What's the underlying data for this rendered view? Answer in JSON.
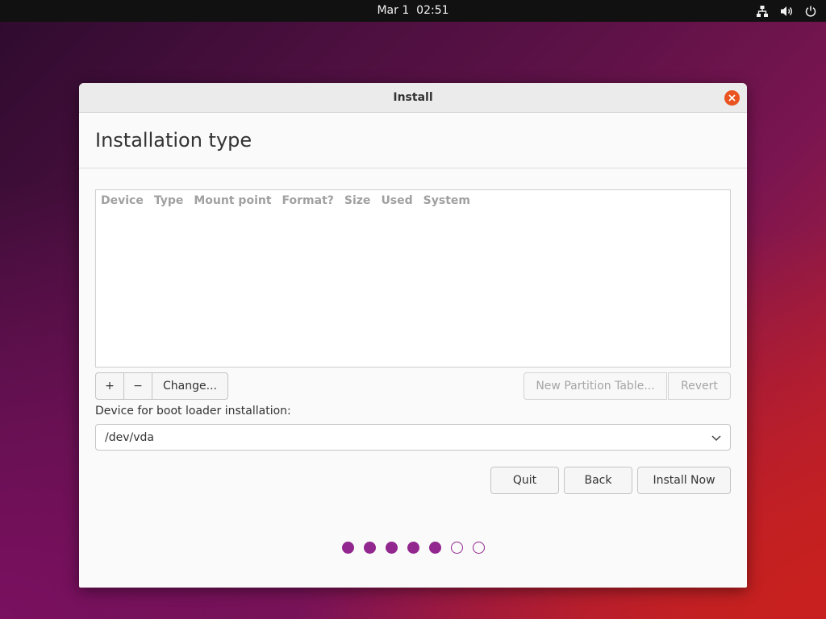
{
  "topbar": {
    "date": "Mar 1",
    "time": "02:51",
    "icons": [
      "network-icon",
      "volume-icon",
      "power-icon"
    ]
  },
  "window": {
    "title": "Install",
    "page_title": "Installation type",
    "table": {
      "columns": [
        "Device",
        "Type",
        "Mount point",
        "Format?",
        "Size",
        "Used",
        "System"
      ],
      "rows": []
    },
    "buttons": {
      "add": "+",
      "remove": "−",
      "change": "Change...",
      "new_partition_table": "New Partition Table...",
      "revert": "Revert",
      "quit": "Quit",
      "back": "Back",
      "install_now": "Install Now"
    },
    "boot_loader": {
      "label": "Device for boot loader installation:",
      "value": "/dev/vda"
    },
    "progress": {
      "total_steps": 7,
      "completed_steps": 5
    }
  },
  "colors": {
    "accent": "#92278f",
    "close": "#e95420"
  }
}
